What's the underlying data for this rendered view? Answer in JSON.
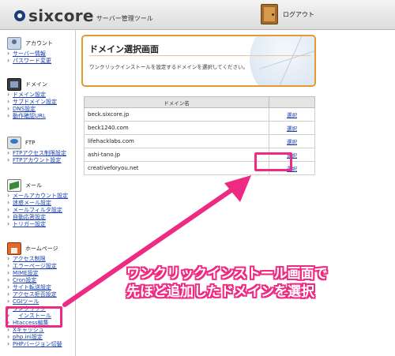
{
  "header": {
    "logo_text": "sixcore",
    "subtitle": "サーバー管理ツール",
    "logout_label": "ログアウト"
  },
  "sidebar": {
    "account": {
      "title": "アカウント",
      "links": [
        "サーバー情報",
        "パスワード変更"
      ]
    },
    "domain": {
      "title": "ドメイン",
      "links": [
        "ドメイン設定",
        "サブドメイン設定",
        "DNS設定",
        "動作確認URL"
      ]
    },
    "ftp": {
      "title": "FTP",
      "links": [
        "FTPアクセス制限設定",
        "FTPアカウント設定"
      ]
    },
    "mail": {
      "title": "メール",
      "links": [
        "メールアカウント設定",
        "迷惑メール設定",
        "メールフィルタ設定",
        "自動応答設定",
        "トリガー設定"
      ]
    },
    "homepage": {
      "title": "ホームページ",
      "links": [
        "アクセス制限",
        "エラーページ設定",
        "MIME設定",
        "Cron設定",
        "サイト転送設定",
        "アクセス拒否設定",
        "CGIツール",
        "ワンクリック",
        "インストール",
        "Htaccess編集",
        "Xキャッシュ",
        "php.ini設定",
        "PHPバージョン切替"
      ]
    }
  },
  "panel": {
    "title": "ドメイン選択画面",
    "description": "ワンクリックインストールを設定するドメインを選択してください。"
  },
  "table": {
    "header": "ドメイン名",
    "rows": [
      {
        "domain": "beck.sixcore.jp",
        "action": "選択"
      },
      {
        "domain": "beck1240.com",
        "action": "選択"
      },
      {
        "domain": "lifehacklabs.com",
        "action": "選択"
      },
      {
        "domain": "ashi-tano.jp",
        "action": "選択"
      },
      {
        "domain": "creativeforyou.net",
        "action": "選択"
      }
    ]
  },
  "annotation": {
    "line1": "ワンクリックインストール画面で",
    "line2": "先ほど追加したドメインを選択",
    "color": "#ee2a82"
  }
}
